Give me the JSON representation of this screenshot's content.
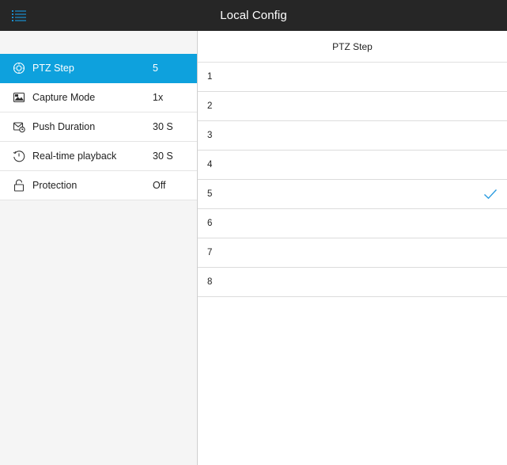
{
  "header": {
    "title": "Local Config",
    "menu_icon": "list-menu-icon"
  },
  "colors": {
    "topbar": "#262626",
    "accent": "#0ea1dd",
    "sidebar_bg": "#f5f5f5"
  },
  "settings": {
    "items": [
      {
        "label": "PTZ Step",
        "value": "5",
        "icon": "ptz-step-icon",
        "selected": true
      },
      {
        "label": "Capture Mode",
        "value": "1x",
        "icon": "capture-mode-icon"
      },
      {
        "label": "Push Duration",
        "value": "30 S",
        "icon": "push-duration-icon"
      },
      {
        "label": "Real-time playback",
        "value": "30 S",
        "icon": "playback-timer-icon"
      },
      {
        "label": "Protection",
        "value": "Off",
        "icon": "lock-icon"
      }
    ]
  },
  "detail": {
    "title": "PTZ Step",
    "options": [
      "1",
      "2",
      "3",
      "4",
      "5",
      "6",
      "7",
      "8"
    ],
    "selected_option": "5",
    "check_icon": "checkmark-icon"
  }
}
